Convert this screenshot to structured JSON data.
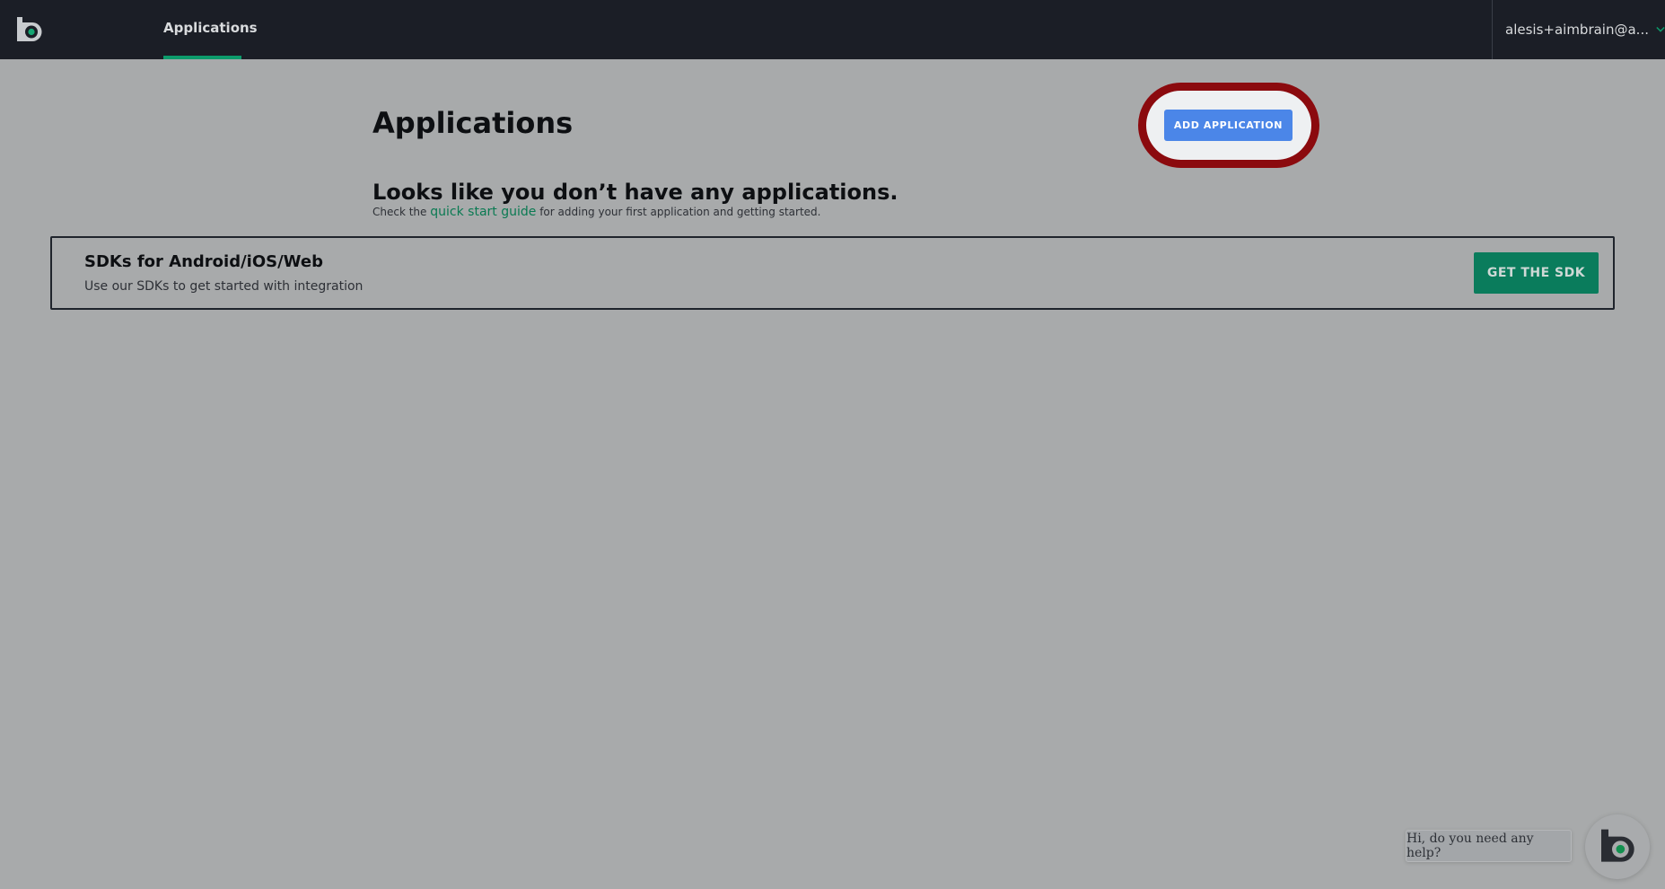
{
  "header": {
    "nav_tab": "Applications",
    "user": "alesis+aimbrain@a..."
  },
  "main": {
    "title": "Applications",
    "add_button": "ADD APPLICATION",
    "empty_title": "Looks like you don’t have any applications.",
    "empty_sub_prefix": "Check the",
    "empty_sub_link": "quick start guide",
    "empty_sub_suffix": "for adding your first application and getting started."
  },
  "sdk_panel": {
    "title": "SDKs for Android/iOS/Web",
    "description": "Use our SDKs to get started with integration",
    "button": "GET THE SDK"
  },
  "help": {
    "message": "Hi, do you need any help?"
  },
  "colors": {
    "header_bg": "#1b1e26",
    "accent_green": "#0c9b6b",
    "primary_blue": "#4b86e8",
    "highlight_red": "#8b0a0e",
    "page_bg": "#a8aaab"
  },
  "icons": {
    "logo": "brand-logo-icon",
    "user_dropdown": "chevron-down-icon"
  }
}
